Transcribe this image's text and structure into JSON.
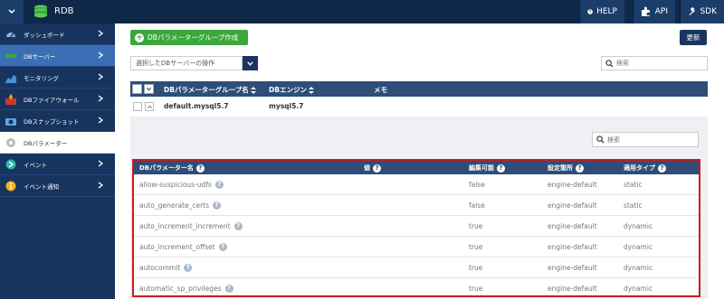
{
  "app": {
    "title": "RDB"
  },
  "topnav": {
    "help": "HELP",
    "api": "API",
    "sdk": "SDK"
  },
  "sidebar": {
    "items": [
      {
        "label": "ダッシュボード",
        "icon": "gauge-icon"
      },
      {
        "label": "DBサーバー",
        "icon": "server-icon"
      },
      {
        "label": "モニタリング",
        "icon": "chart-icon"
      },
      {
        "label": "DBファイアウォール",
        "icon": "firewall-icon"
      },
      {
        "label": "DBスナップショット",
        "icon": "camera-icon"
      },
      {
        "label": "DBパラメーター",
        "icon": "parameter-icon"
      },
      {
        "label": "イベント",
        "icon": "event-icon"
      },
      {
        "label": "イベント通知",
        "icon": "info-icon"
      }
    ]
  },
  "toolbar": {
    "create_label": "DBパラメーターグループ作成",
    "refresh_label": "更新",
    "operation_placeholder": "選択したDBサーバーの操作",
    "search_placeholder": "検索"
  },
  "group_table": {
    "headers": [
      "DBパラメーターグループ名",
      "DBエンジン",
      "メモ"
    ],
    "rows": [
      {
        "name": "default.mysql5.7",
        "engine": "mysql5.7",
        "memo": ""
      }
    ]
  },
  "param_search_placeholder": "検索",
  "param_table": {
    "headers": [
      "DBパラメーター名",
      "値",
      "編集可能",
      "設定箇所",
      "適用タイプ"
    ],
    "rows": [
      {
        "name": "allow-suspicious-udfs",
        "value": "",
        "editable": "false",
        "source": "engine-default",
        "apply_type": "static"
      },
      {
        "name": "auto_generate_certs",
        "value": "",
        "editable": "false",
        "source": "engine-default",
        "apply_type": "static"
      },
      {
        "name": "auto_increment_increment",
        "value": "",
        "editable": "true",
        "source": "engine-default",
        "apply_type": "dynamic"
      },
      {
        "name": "auto_increment_offset",
        "value": "",
        "editable": "true",
        "source": "engine-default",
        "apply_type": "dynamic"
      },
      {
        "name": "autocommit",
        "value": "",
        "editable": "true",
        "source": "engine-default",
        "apply_type": "dynamic"
      },
      {
        "name": "automatic_sp_privileges",
        "value": "",
        "editable": "true",
        "source": "engine-default",
        "apply_type": "dynamic"
      }
    ]
  },
  "colors": {
    "topbar": "#0f2847",
    "sidebar": "#17345e",
    "accent_green": "#3aa83a",
    "table_header": "#2e4d78",
    "highlight_border": "#cc1a1a"
  }
}
